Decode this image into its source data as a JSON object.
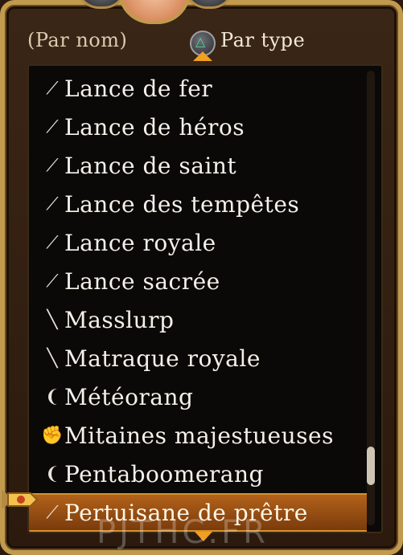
{
  "sort": {
    "by_name_label": "(Par nom)",
    "by_type_label": "Par type",
    "triangle_glyph": "△"
  },
  "items": [
    {
      "icon": "spear-icon",
      "label": "Lance de fer"
    },
    {
      "icon": "spear-icon",
      "label": "Lance de héros"
    },
    {
      "icon": "spear-icon",
      "label": "Lance de saint"
    },
    {
      "icon": "spear-icon",
      "label": "Lance des tempêtes"
    },
    {
      "icon": "spear-icon",
      "label": "Lance royale"
    },
    {
      "icon": "spear-icon",
      "label": "Lance sacrée"
    },
    {
      "icon": "staff-icon",
      "label": "Masslurp"
    },
    {
      "icon": "staff-icon",
      "label": "Matraque royale"
    },
    {
      "icon": "boomerang-icon",
      "label": "Météorang"
    },
    {
      "icon": "gauntlet-icon",
      "label": "Mitaines majestueuses"
    },
    {
      "icon": "boomerang-icon",
      "label": "Pentaboomerang"
    },
    {
      "icon": "spear-icon",
      "label": "Pertuisane de prêtre",
      "selected": true
    }
  ],
  "watermark": "PJTHC.FR",
  "colors": {
    "frame_gold": "#c29a4e",
    "selection_orange": "#b3621a",
    "accent_arrow": "#f0a020"
  }
}
